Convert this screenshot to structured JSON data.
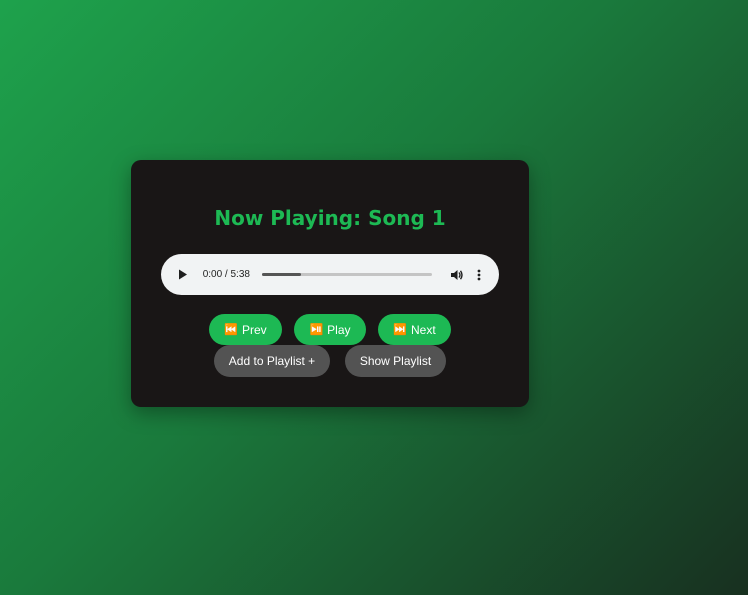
{
  "player": {
    "title": "Now Playing: Song 1",
    "audio": {
      "current_time": "0:00",
      "duration": "5:38",
      "time_display": "0:00 / 5:38",
      "progress_fraction": 0.23
    },
    "controls": {
      "prev_icon": "⏮️",
      "prev_label": "Prev",
      "play_icon": "⏯️",
      "play_label": "Play",
      "next_icon": "⏭️",
      "next_label": "Next"
    },
    "actions": {
      "add_to_playlist_label": "Add to Playlist +",
      "show_playlist_label": "Show Playlist"
    }
  },
  "colors": {
    "accent": "#1db954",
    "card_bg": "#191616",
    "secondary_button": "#535353"
  }
}
